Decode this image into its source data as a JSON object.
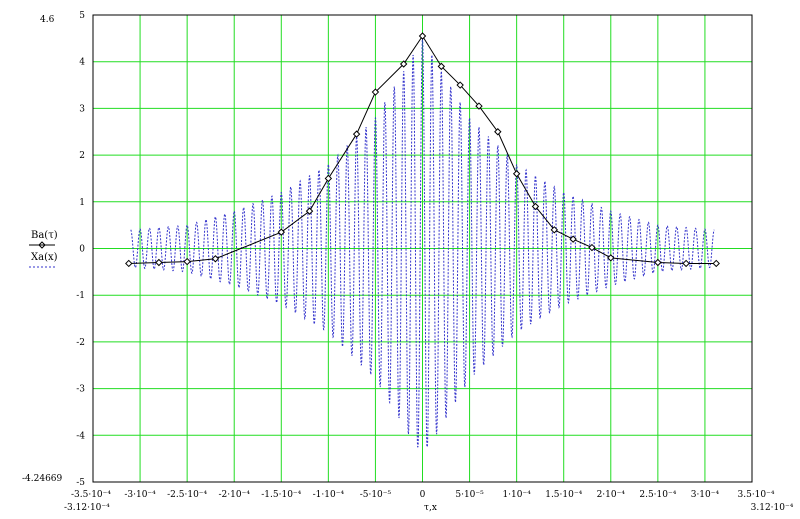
{
  "chart_data": {
    "type": "line",
    "title": "",
    "xlabel": "τ,x",
    "ylabel": "",
    "xlim": [
      -0.00035,
      0.00035
    ],
    "ylim": [
      -5,
      5
    ],
    "grid": true,
    "grid_color": "#22dd22",
    "x_ticks": [
      -0.0003,
      -0.00025,
      -0.0002,
      -0.00015,
      -0.0001,
      -5e-05,
      0,
      5e-05,
      0.0001,
      0.00015,
      0.0002,
      0.00025,
      0.0003
    ],
    "x_tick_labels": [
      "-3·10⁻⁴",
      "-2.5·10⁻⁴",
      "-2·10⁻⁴",
      "-1.5·10⁻⁴",
      "-1·10⁻⁴",
      "-5·10⁻⁵",
      "0",
      "5·10⁻⁵",
      "1·10⁻⁴",
      "1.5·10⁻⁴",
      "2·10⁻⁴",
      "2.5·10⁻⁴",
      "3·10⁻⁴"
    ],
    "x_edge_labels": [
      "-3.5·10⁻⁴",
      "3.5·10⁻⁴"
    ],
    "y_ticks": [
      5,
      4,
      3,
      2,
      1,
      0,
      -1,
      -2,
      -3,
      -4,
      -5
    ],
    "y_tick_labels": [
      "5",
      "4",
      "3",
      "2",
      "1",
      "0",
      "-1",
      "-2",
      "-3",
      "-4",
      "-5"
    ],
    "corner_labels": {
      "y_top": "4.6",
      "y_bottom": "-4.24669",
      "x_left": "-3.12·10⁻⁴",
      "x_right": "3.12·10⁻⁴"
    },
    "legend": {
      "placement": "left",
      "entries": [
        "Ba(τ)",
        "Xa(x)"
      ]
    },
    "series": [
      {
        "name": "Ba(τ)",
        "style": "solid",
        "color": "#000000",
        "marker": "diamond",
        "x": [
          -0.000312,
          -0.00028,
          -0.00025,
          -0.00022,
          -0.00015,
          -0.00012,
          -0.0001,
          -7e-05,
          -5e-05,
          -2e-05,
          0,
          2e-05,
          4e-05,
          6e-05,
          8e-05,
          0.0001,
          0.00012,
          0.00014,
          0.00016,
          0.00018,
          0.0002,
          0.00025,
          0.00028,
          0.000312
        ],
        "y": [
          -0.32,
          -0.3,
          -0.28,
          -0.22,
          0.35,
          0.8,
          1.5,
          2.45,
          3.35,
          3.95,
          4.55,
          3.9,
          3.5,
          3.05,
          2.5,
          1.6,
          0.9,
          0.4,
          0.2,
          0.02,
          -0.2,
          -0.3,
          -0.32,
          -0.32
        ]
      },
      {
        "name": "Xa(x)",
        "style": "dashed",
        "color": "#3333cc",
        "amplitude_envelope": {
          "x": [
            -0.00031,
            -0.00025,
            -0.0002,
            -0.00015,
            -0.0001,
            -5e-05,
            -2e-05,
            0,
            2e-05,
            5e-05,
            0.0001,
            0.00015,
            0.0002,
            0.00025,
            0.00031
          ],
          "y": [
            0.4,
            0.5,
            0.8,
            1.2,
            1.8,
            2.8,
            3.8,
            4.5,
            3.8,
            2.8,
            1.8,
            1.2,
            0.8,
            0.5,
            0.4
          ]
        },
        "min_value": -4.24669,
        "max_value": 4.6,
        "oscillation_period": 1e-05
      }
    ]
  }
}
